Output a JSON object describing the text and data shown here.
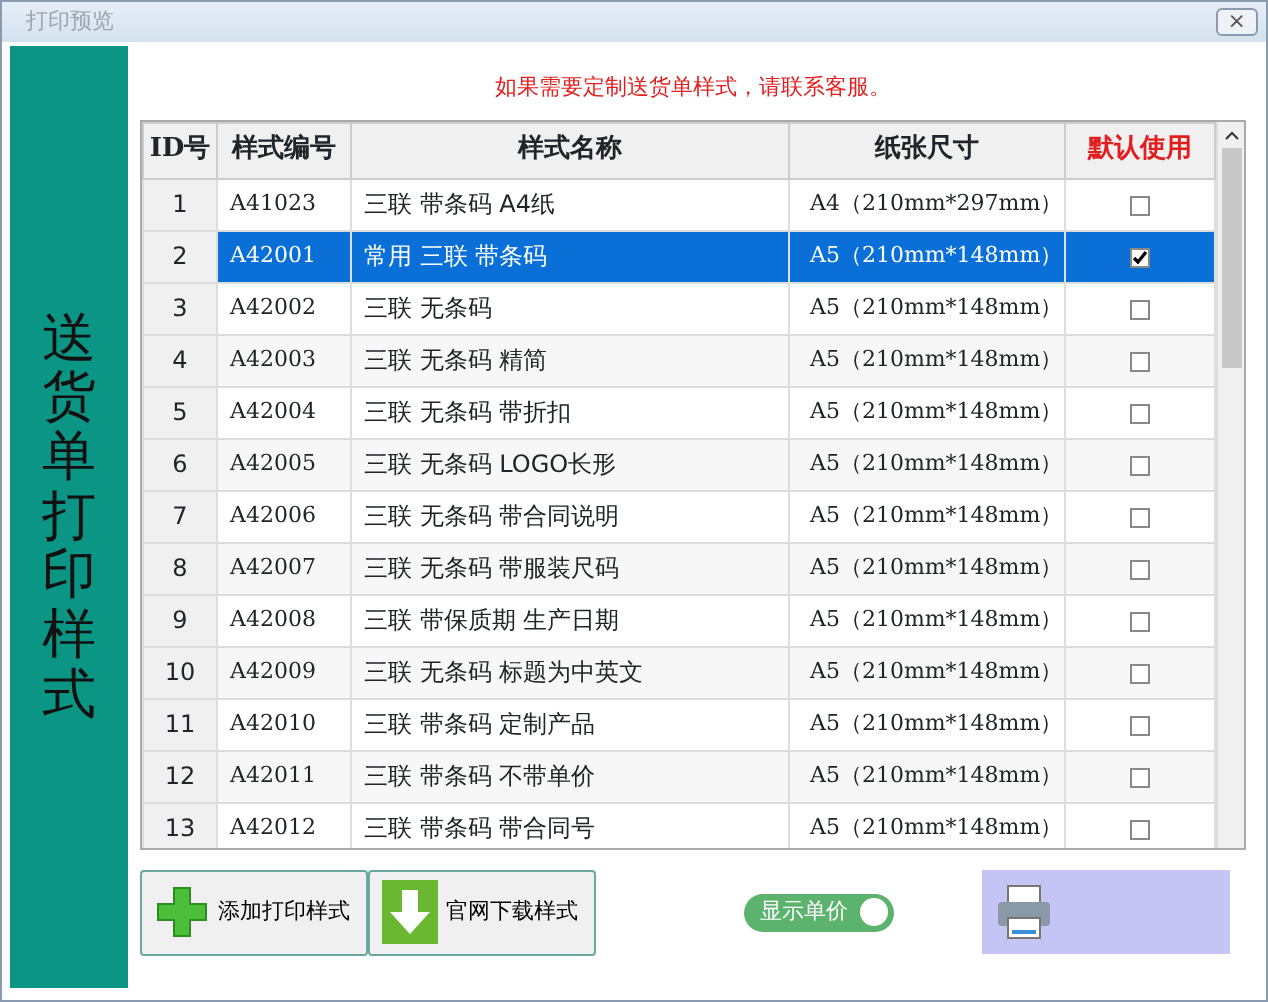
{
  "window": {
    "title": "打印预览",
    "close": "×"
  },
  "sidebar": {
    "title": "送货单打印样式"
  },
  "notice": "如果需要定制送货单样式，请联系客服。",
  "table": {
    "columns": [
      "ID号",
      "样式编号",
      "样式名称",
      "纸张尺寸",
      "默认使用"
    ],
    "rows": [
      {
        "id": "1",
        "code": "A41023",
        "name": "三联 带条码 A4纸",
        "paper": "A4（210mm*297mm）",
        "checked": false,
        "selected": false
      },
      {
        "id": "2",
        "code": "A42001",
        "name": "常用 三联 带条码",
        "paper": "A5（210mm*148mm）",
        "checked": true,
        "selected": true
      },
      {
        "id": "3",
        "code": "A42002",
        "name": "三联 无条码",
        "paper": "A5（210mm*148mm）",
        "checked": false,
        "selected": false
      },
      {
        "id": "4",
        "code": "A42003",
        "name": "三联 无条码 精简",
        "paper": "A5（210mm*148mm）",
        "checked": false,
        "selected": false
      },
      {
        "id": "5",
        "code": "A42004",
        "name": "三联 无条码 带折扣",
        "paper": "A5（210mm*148mm）",
        "checked": false,
        "selected": false
      },
      {
        "id": "6",
        "code": "A42005",
        "name": "三联 无条码 LOGO长形",
        "paper": "A5（210mm*148mm）",
        "checked": false,
        "selected": false
      },
      {
        "id": "7",
        "code": "A42006",
        "name": "三联 无条码 带合同说明",
        "paper": "A5（210mm*148mm）",
        "checked": false,
        "selected": false
      },
      {
        "id": "8",
        "code": "A42007",
        "name": "三联 无条码 带服装尺码",
        "paper": "A5（210mm*148mm）",
        "checked": false,
        "selected": false
      },
      {
        "id": "9",
        "code": "A42008",
        "name": "三联 带保质期 生产日期",
        "paper": "A5（210mm*148mm）",
        "checked": false,
        "selected": false
      },
      {
        "id": "10",
        "code": "A42009",
        "name": "三联 无条码 标题为中英文",
        "paper": "A5（210mm*148mm）",
        "checked": false,
        "selected": false
      },
      {
        "id": "11",
        "code": "A42010",
        "name": "三联 带条码 定制产品",
        "paper": "A5（210mm*148mm）",
        "checked": false,
        "selected": false
      },
      {
        "id": "12",
        "code": "A42011",
        "name": "三联 带条码 不带单价",
        "paper": "A5（210mm*148mm）",
        "checked": false,
        "selected": false
      },
      {
        "id": "13",
        "code": "A42012",
        "name": "三联 带条码 带合同号",
        "paper": "A5（210mm*148mm）",
        "checked": false,
        "selected": false
      }
    ]
  },
  "buttons": [
    {
      "kind": "add",
      "label": "添加打印样式"
    },
    {
      "kind": "download",
      "label": "官网下载样式"
    }
  ],
  "toggle": {
    "label": "显示单价",
    "on": true
  },
  "print_button": {
    "kind": "print"
  }
}
